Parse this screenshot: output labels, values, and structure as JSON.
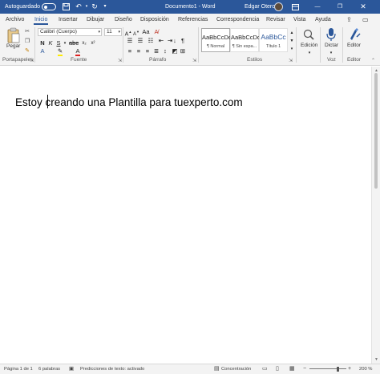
{
  "titlebar": {
    "autosave_label": "Autoguardado",
    "toggle_state": "off",
    "title": "Documento1 - Word",
    "user_name": "Edgar Otero",
    "color": "#2b579a"
  },
  "tabs": [
    {
      "label": "Archivo",
      "active": false
    },
    {
      "label": "Inicio",
      "active": true
    },
    {
      "label": "Insertar",
      "active": false
    },
    {
      "label": "Dibujar",
      "active": false
    },
    {
      "label": "Diseño",
      "active": false
    },
    {
      "label": "Disposición",
      "active": false
    },
    {
      "label": "Referencias",
      "active": false
    },
    {
      "label": "Correspondencia",
      "active": false
    },
    {
      "label": "Revisar",
      "active": false
    },
    {
      "label": "Vista",
      "active": false
    },
    {
      "label": "Ayuda",
      "active": false
    }
  ],
  "ribbon": {
    "clipboard": {
      "paste_label": "Pegar",
      "group_label": "Portapapeles"
    },
    "font": {
      "font_name": "Calibri (Cuerpo)",
      "font_size": "11",
      "group_label": "Fuente"
    },
    "paragraph": {
      "group_label": "Párrafo"
    },
    "styles": {
      "group_label": "Estilos",
      "items": [
        {
          "sample": "AaBbCcDc",
          "name": "¶ Normal",
          "selected": true
        },
        {
          "sample": "AaBbCcDc",
          "name": "¶ Sin espa...",
          "selected": false
        },
        {
          "sample": "AaBbCc",
          "name": "Título 1",
          "selected": false
        }
      ]
    },
    "editing": {
      "label": "Edición"
    },
    "voice": {
      "label": "Dictar",
      "group_label": "Voz"
    },
    "editor": {
      "label": "Editor",
      "group_label": "Editor"
    }
  },
  "document": {
    "text": "Estoy creando una Plantilla para tuexperto.com"
  },
  "statusbar": {
    "page": "Página 1 de 1",
    "words": "6 palabras",
    "text_predictions": "Predicciones de texto: activado",
    "focus": "Concentración",
    "zoom": "200 %"
  }
}
